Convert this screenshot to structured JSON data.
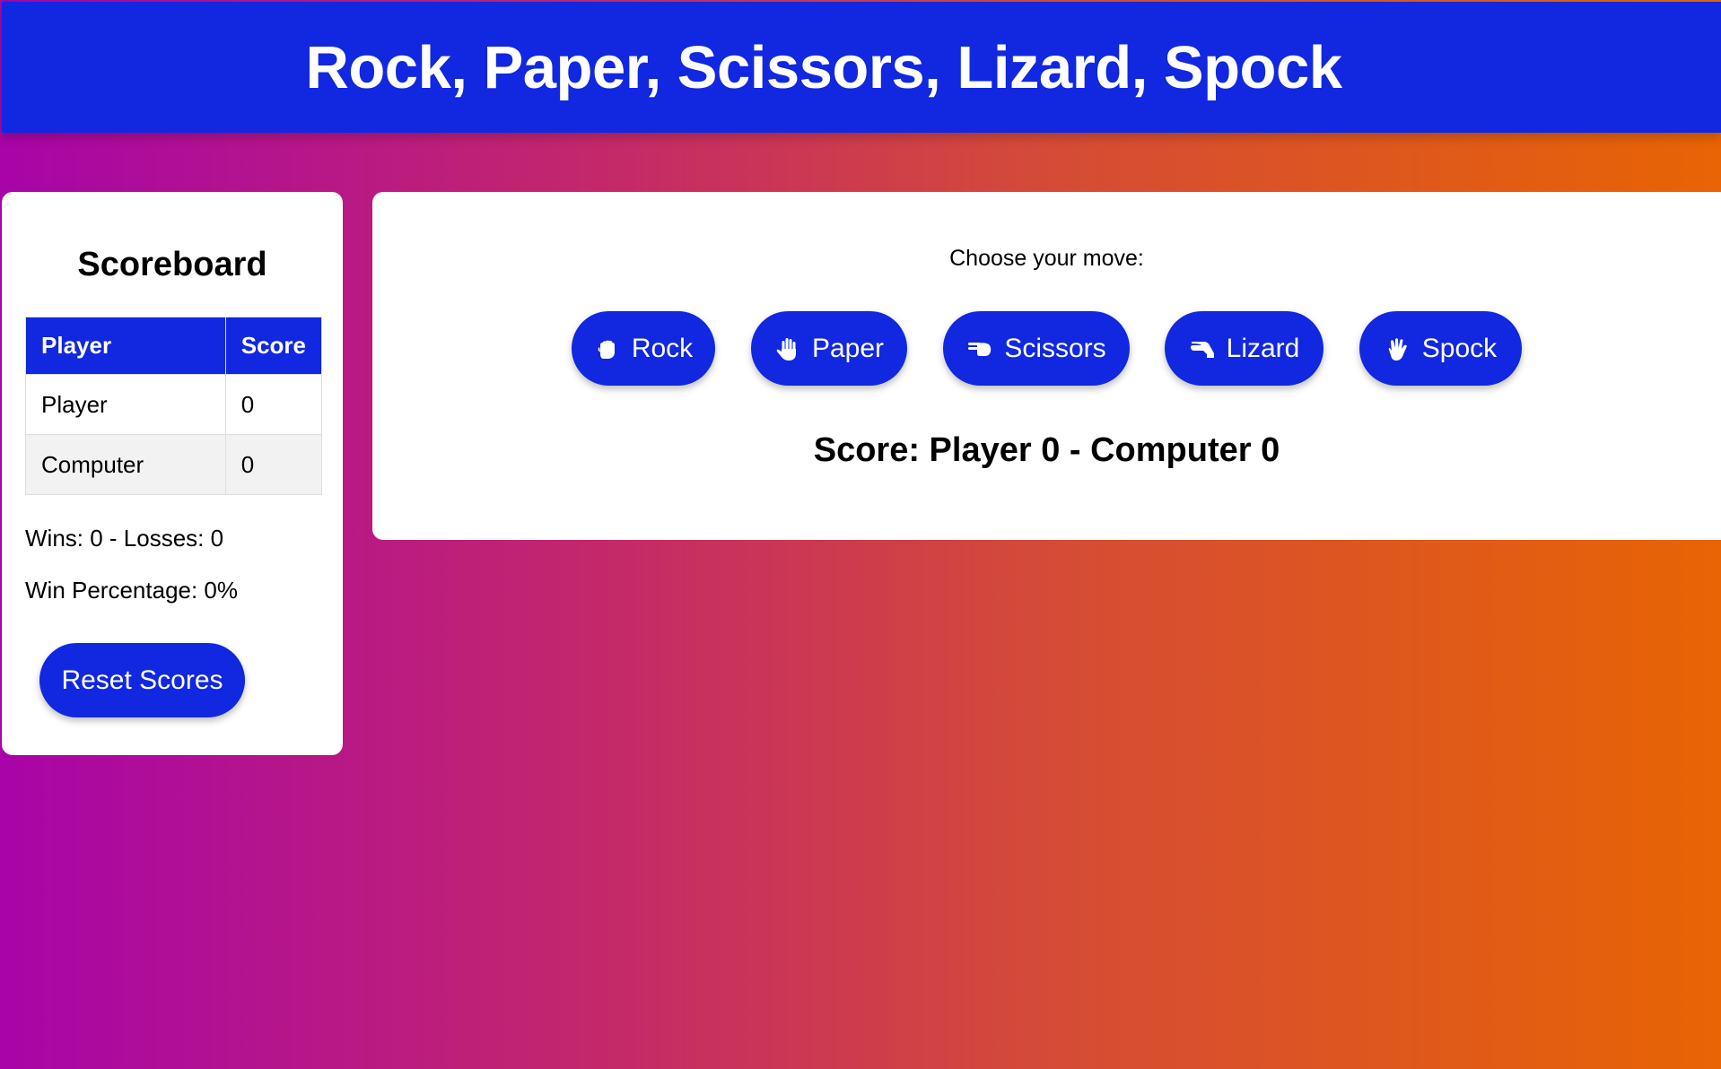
{
  "header": {
    "title": "Rock, Paper, Scissors, Lizard, Spock"
  },
  "scoreboard": {
    "title": "Scoreboard",
    "columns": [
      "Player",
      "Score"
    ],
    "rows": [
      {
        "name": "Player",
        "score": "0"
      },
      {
        "name": "Computer",
        "score": "0"
      }
    ],
    "wins_losses": "Wins: 0 - Losses: 0",
    "win_percentage": "Win Percentage: 0%",
    "reset_label": "Reset Scores"
  },
  "game": {
    "prompt": "Choose your move:",
    "moves": [
      {
        "label": "Rock",
        "icon": "hand-rock-icon"
      },
      {
        "label": "Paper",
        "icon": "hand-paper-icon"
      },
      {
        "label": "Scissors",
        "icon": "hand-scissors-icon"
      },
      {
        "label": "Lizard",
        "icon": "hand-lizard-icon"
      },
      {
        "label": "Spock",
        "icon": "hand-spock-icon"
      }
    ],
    "score_text": "Score: Player 0 - Computer 0"
  },
  "colors": {
    "primary": "#1127e0",
    "gradient_start": "#a804a8",
    "gradient_end": "#e86404"
  }
}
